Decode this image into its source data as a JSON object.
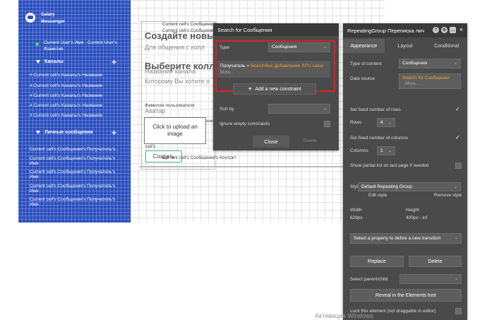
{
  "sidebar": {
    "title_line1": "Salary",
    "title_line2": "Messenger",
    "user_name": "Current User's Имя",
    "user_surname": "Current User's",
    "user_surname2": "Фамилия",
    "channels_label": "Каналы",
    "channel_rows": [
      "# Current cell's Каналы's Название",
      "# Current cell's Каналы's Название",
      "# Current cell's Каналы's Название",
      "# Current cell's Каналы's Название",
      "# Current cell's Каналы's Название",
      "# Current cell's Каналы's Название"
    ],
    "dm_label": "Личные сообщения",
    "dm_rows": [
      "Current cell's Сообщения's Получатель's...",
      "Current cell's Сообщения's Получатель's",
      "Имя",
      "Current cell's Сообщения's Получатель's",
      "Имя",
      "Current cell's Сообщения's Получатель's",
      "Имя",
      "Current cell's Сообщения's Получатель's",
      "Имя"
    ]
  },
  "canvas": {
    "cell_text_1": "Current cell's Сообщения's",
    "cell_text_2": "Current cell's Сообщения's",
    "cell_text_3": "Current cell's Сообщения's",
    "heading_create": "Создайте новы",
    "sub_create": "Для общения с колл",
    "heading_select": "Выберите колл",
    "label_channel_name": "Название канала",
    "label_who": "Которому Вы хотите о",
    "label_channel_name2": "Фамилия пользователя",
    "label_avatar": "Аватар",
    "upload_text": "Click to upload an image",
    "cells_label": "cell's",
    "create_button": "Создать",
    "bottom_cell_text": "Current cell's Сообщения's Контркт"
  },
  "search_dialog": {
    "title": "Search for Сообщения",
    "type_label": "Type",
    "type_value": "Сообщения",
    "constraint_field": "Получатель",
    "constraint_op": "=",
    "constraint_value": "SearchBox Добавление ЛП's value",
    "constraint_more": "More...",
    "add_constraint": "Add a new constraint",
    "sort_by_label": "Sort by",
    "ignore_empty": "Ignore empty constraints",
    "close_button": "Close",
    "delete_button": "Delete"
  },
  "property_editor": {
    "title": "RepeatingGroup Переписка лич",
    "tabs": [
      "Appearance",
      "Layout",
      "Conditional"
    ],
    "type_of_content_label": "Type of content",
    "type_of_content_value": "Сообщения",
    "data_source_label": "Data source",
    "data_source_value": "Search for Сообщения",
    "data_source_more": "More...",
    "fixed_rows_label": "Set fixed number of rows",
    "rows_label": "Rows",
    "rows_value": "4",
    "fixed_cols_label": "Set fixed number of columns",
    "columns_label": "Columns",
    "columns_value": "1",
    "partial_list_label": "Show partial list on last page if needed",
    "style_label": "Style",
    "style_value": "Default Repeating Group",
    "edit_style": "Edit style",
    "remove_style": "Remove style",
    "width_label": "Width",
    "width_value": "629px",
    "height_label": "Height",
    "height_value": "400px - inf",
    "transition_placeholder": "Select a property to define a new transition",
    "replace_button": "Replace",
    "delete_button": "Delete",
    "select_parent_label": "Select parent/child",
    "reveal_button": "Reveal in the Elements tree",
    "lock_label": "Lock this element (not draggable in editor)"
  },
  "watermark": "Активация Windows"
}
